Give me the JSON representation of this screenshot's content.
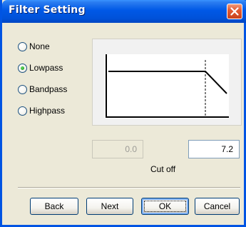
{
  "window": {
    "title": "Filter Setting"
  },
  "filter_type": {
    "options": [
      {
        "label": "None",
        "selected": false
      },
      {
        "label": "Lowpass",
        "selected": true
      },
      {
        "label": "Bandpass",
        "selected": false
      },
      {
        "label": "Highpass",
        "selected": false
      }
    ]
  },
  "cutoff": {
    "disabled_value": "0.0",
    "value": "7.2",
    "label": "Cut off"
  },
  "buttons": {
    "back": "Back",
    "next": "Next",
    "ok": "OK",
    "cancel": "Cancel"
  },
  "colors": {
    "titlebar": "#0058E6",
    "dialog_bg": "#ECE9D8",
    "close_button": "#E35B34"
  }
}
